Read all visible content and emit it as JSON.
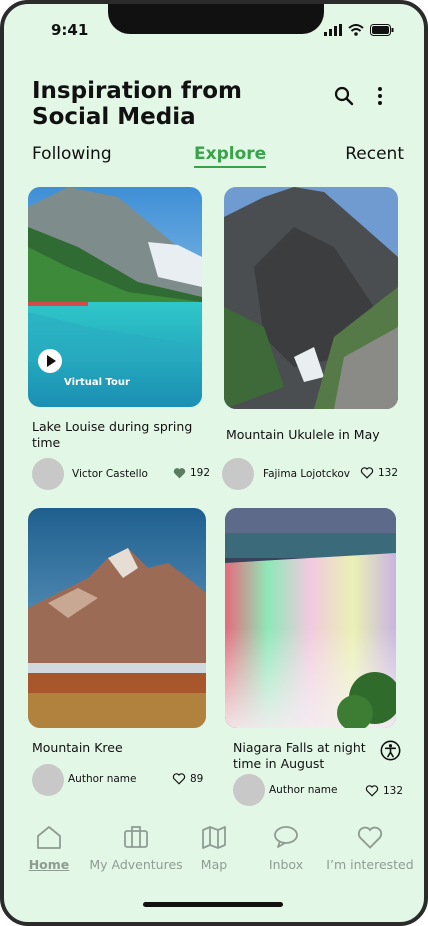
{
  "status_bar": {
    "time": "9:41"
  },
  "header": {
    "title": "Inspiration from Social Media"
  },
  "tabs": [
    {
      "label": "Following"
    },
    {
      "label": "Explore"
    },
    {
      "label": "Recent"
    }
  ],
  "posts": [
    {
      "caption": "Lake Louise during spring time",
      "author": "Victor Castello",
      "likes": "192",
      "badge": "Virtual Tour"
    },
    {
      "caption": "Mountain Ukulele in May",
      "author": "Fajima Lojotckov",
      "likes": "132"
    },
    {
      "caption": "Mountain Kree",
      "author": "Author name",
      "likes": "89"
    },
    {
      "caption": "Niagara Falls at night time in August",
      "author": "Author name",
      "likes": "132"
    }
  ],
  "nav": [
    {
      "label": "Home"
    },
    {
      "label": "My Adventures"
    },
    {
      "label": "Map"
    },
    {
      "label": "Inbox"
    },
    {
      "label": "I’m interested"
    }
  ],
  "colors": {
    "accent": "#38a34a",
    "background": "#e3f7e6",
    "nav_inactive": "#8f9c92",
    "liked_heart": "#5a7d5f"
  }
}
